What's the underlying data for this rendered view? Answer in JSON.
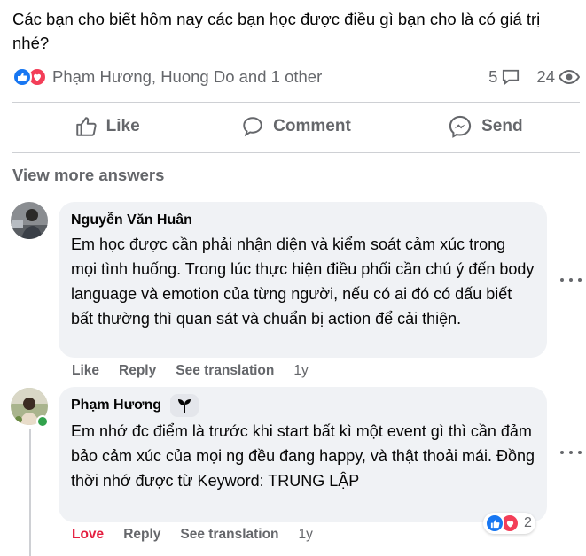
{
  "post": {
    "text": "Các bạn cho biết hôm nay các bạn học được điều gì bạn cho là có giá trị nhé?",
    "reactors": "Phạm Hương, Huong Do and 1 other",
    "comment_count": "5",
    "view_count": "24"
  },
  "actions": {
    "like": "Like",
    "comment": "Comment",
    "send": "Send"
  },
  "view_more": "View more answers",
  "comments": [
    {
      "author": "Nguyễn Văn Huân",
      "text": "Em học được cần phải nhận diện và kiểm soát cảm xúc trong mọi tình huống. Trong lúc thực hiện điều phối cần chú ý đến body language và emotion của từng người, nếu có ai đó có dấu biết bất thường thì quan sát và chuẩn bị action để cải thiện.",
      "like": "Like",
      "reply": "Reply",
      "translate": "See translation",
      "time": "1y"
    },
    {
      "author": "Phạm Hương",
      "text": "Em nhớ đc điểm là trước khi start bất kì một event gì thì cần đảm bảo cảm xúc của mọi ng đều đang happy, và thật thoải mái. Đồng thời nhớ được từ Keyword: TRUNG LẬP",
      "like": "Love",
      "reply": "Reply",
      "translate": "See translation",
      "time": "1y",
      "reaction_count": "2"
    }
  ],
  "colors": {
    "like_blue": "#1877f2",
    "love_red": "#f33e58",
    "secondary_text": "#65676b",
    "bubble_bg": "#f0f2f5",
    "online_green": "#31a24c"
  },
  "icons": [
    "like-reaction-icon",
    "love-reaction-icon",
    "comment-bubble-icon",
    "eye-icon",
    "thumbs-up-icon",
    "messenger-icon",
    "more-options-icon",
    "sprout-badge-icon"
  ]
}
